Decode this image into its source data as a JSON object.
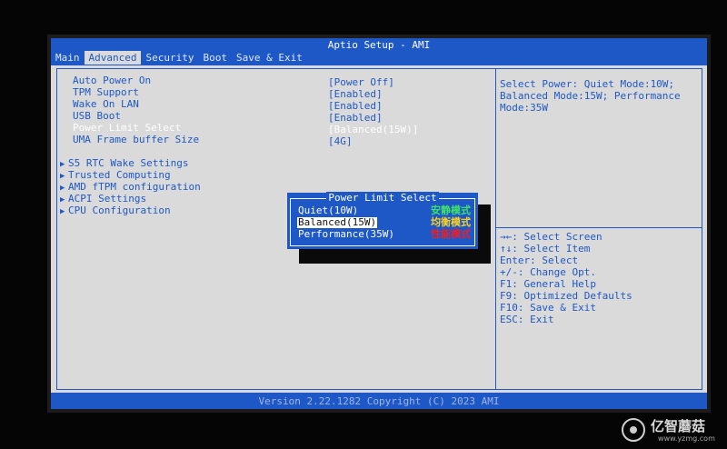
{
  "header": {
    "title": "Aptio Setup - AMI",
    "tabs": [
      "Main",
      "Advanced",
      "Security",
      "Boot",
      "Save & Exit"
    ],
    "active_tab": "Advanced"
  },
  "settings": [
    {
      "label": "Auto Power On",
      "value": "[Power Off]"
    },
    {
      "label": "TPM Support",
      "value": "[Enabled]"
    },
    {
      "label": "Wake On LAN",
      "value": "[Enabled]"
    },
    {
      "label": "USB Boot",
      "value": "[Enabled]"
    },
    {
      "label": "Power Limit Select",
      "value": "[Balanced(15W)]",
      "selected": true
    },
    {
      "label": "UMA Frame buffer Size",
      "value": "[4G]"
    }
  ],
  "submenus": [
    "S5 RTC Wake Settings",
    "Trusted Computing",
    "AMD fTPM configuration",
    "ACPI Settings",
    "CPU Configuration"
  ],
  "help_text": "Select Power: Quiet Mode:10W; Balanced Mode:15W; Performance Mode:35W",
  "key_help": [
    "→←: Select Screen",
    "↑↓: Select Item",
    "Enter: Select",
    "+/-: Change Opt.",
    "F1: General Help",
    "F9: Optimized Defaults",
    "F10: Save & Exit",
    "ESC: Exit"
  ],
  "popup": {
    "title": "Power Limit Select",
    "options": [
      {
        "label": "Quiet(10W)",
        "annotation": "安静模式",
        "annotation_color": "#3ee06a"
      },
      {
        "label": "Balanced(15W)",
        "annotation": "均衡模式",
        "annotation_color": "#ffd21e",
        "selected": true
      },
      {
        "label": "Performance(35W)",
        "annotation": "性能模式",
        "annotation_color": "#e8202a"
      }
    ]
  },
  "footer": {
    "version": "Version 2.22.1282 Copyright (C) 2023 AMI"
  },
  "watermark": {
    "name": "亿智蘑菇",
    "url": "www.yzmg.com"
  },
  "colors": {
    "bios_blue": "#1e58c6",
    "panel_gray": "#dadada"
  }
}
